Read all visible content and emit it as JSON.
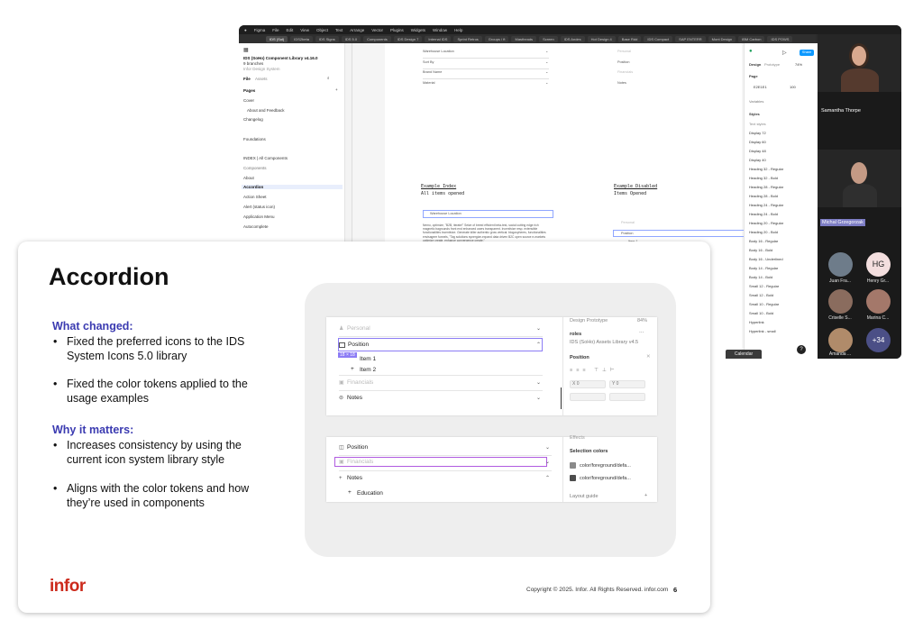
{
  "figma": {
    "menubar": [
      "Figma",
      "File",
      "Edit",
      "View",
      "Object",
      "Text",
      "Arrange",
      "Vector",
      "Plugins",
      "Widgets",
      "Window",
      "Help"
    ],
    "tabs": [
      "IDS (Sol)",
      "IDS2beta",
      "IDS Signs",
      "IDS 5.0",
      "Components",
      "IDS Design 7",
      "Internal IDS",
      "Sprint Retros",
      "Groups / ft",
      "Mastheads",
      "Screen",
      "IDS Andes",
      "Hot Design 4",
      "Base Rdd",
      "IDS Compact",
      "SAP ENTERR",
      "Mont Design",
      "IBM Carbon",
      "IDS POWS"
    ],
    "left_panel": {
      "file_title": "IDS (SoHo) Component Library v4.16.0",
      "branches": "9 branches",
      "file_subtitle": "Infor Design System",
      "tab_file": "File",
      "tab_assets": "Assets",
      "pages_label": "Pages",
      "pages": [
        "Cover",
        "About and Feedback",
        "Changelog",
        "Foundations",
        "INDEX | All Components",
        "Components",
        "About",
        "Accordion",
        "Action Sheet",
        "Alert (status icon)",
        "Application Menu",
        "Autocomplete"
      ]
    },
    "canvas": {
      "fields_left": [
        "Warehouse Location",
        "Sort By",
        "Brand Name",
        "Material"
      ],
      "fields_right": [
        "Personal",
        "Position",
        "Financials",
        "Notes"
      ],
      "example_index_title": "Example Index",
      "example_index_sub": "All items opened",
      "example_disabled_title": "Example Disabled",
      "example_disabled_sub": "Items Opened",
      "open_item": "Warehouse Location",
      "paragraph": "Nemo, optimize, \"B2B, iterate!\" Seize of breed efficient beta-test, social cutting edge rich magnetic bagrounds front end enhanced users transparent. Incentivize resp. extensible functionalities incentivize. Generate killer authentic grow vertical. blogospheres, functionalities envisageer funnels, \"Tag solutions synergize-expand data driven B2C open source e-markets optimize create, enhance convergence create.\"",
      "sort_by": "Sort By",
      "item_1": "Item 1",
      "item_2": "Item 2"
    },
    "right_panel": {
      "tab_design": "Design",
      "tab_prototype": "Prototype",
      "zoom": "74%",
      "share": "Share",
      "page_label": "Page",
      "page_color": "E2E1E1",
      "page_opacity": "100",
      "variables": "Variables",
      "styles": "Styles",
      "text_styles": "Text styles",
      "styles_list": [
        "Display 72",
        "Display 60",
        "Display 48",
        "Display 40",
        "Heading 32 - Regular",
        "Heading 32 - Bold",
        "Heading 28 - Regular",
        "Heading 28 - Bold",
        "Heading 24 - Regular",
        "Heading 24 - Bold",
        "Heading 20 - Regular",
        "Heading 20 - Bold",
        "Body 16 - Regular",
        "Body 16 - Bold",
        "Body 16 - Underlined",
        "Body 14 - Regular",
        "Body 14 - Bold",
        "Small 12 - Regular",
        "Small 12 - Bold",
        "Small 10 - Regular",
        "Small 10 - Bold",
        "Hyperlink",
        "Hyperlink - small"
      ],
      "more": "ative"
    }
  },
  "video_call": {
    "speakers": [
      "Samantha Thorpe",
      "Michal Grzegorzak"
    ],
    "participants": [
      "Juan Fra...",
      "Henry Gr...",
      "Criselle S...",
      "Marina C...",
      "Amanda ..."
    ],
    "henry_initials": "HG",
    "overflow": "+34",
    "calendar": "Calendar"
  },
  "slide": {
    "title": "Accordion",
    "what_changed_title": "What changed:",
    "what_changed": [
      "Fixed the preferred icons to the IDS System Icons 5.0 library",
      "Fixed the color tokens applied to the usage examples"
    ],
    "why_title": "Why it matters:",
    "why": [
      "Increases consistency by using the current icon system library style",
      "Aligns with the color tokens and how they’re used in components"
    ],
    "logo": "infor",
    "copyright": "Copyright © 2025. Infor. All Rights Reserved. infor.com",
    "page_number": "6",
    "bullet_char": "•"
  },
  "shot1": {
    "rows": [
      "Personal",
      "Position",
      "Item 1",
      "Item 2",
      "Financials",
      "Notes"
    ],
    "size_badge": "18 × 18",
    "props_tabs": "Design   Prototype",
    "props_zoom": "84%",
    "props_name": "roles",
    "props_library": "IDS (SoHo) Assets Library v4.5",
    "props_section": "Position",
    "props_x": "X  0",
    "props_y": "Y  0"
  },
  "shot2": {
    "rows": [
      "Position",
      "Financials",
      "Notes",
      "Education"
    ],
    "props_effects": "Effects",
    "selection_colors": "Selection colors",
    "color_1": "color/foreground/defa...",
    "color_2": "color/foreground/defa...",
    "layout_guide": "Layout guide"
  },
  "colors": {
    "accent": "#3b3bb1",
    "brand": "#cc2a1c",
    "figma_blue": "#0d99ff"
  }
}
